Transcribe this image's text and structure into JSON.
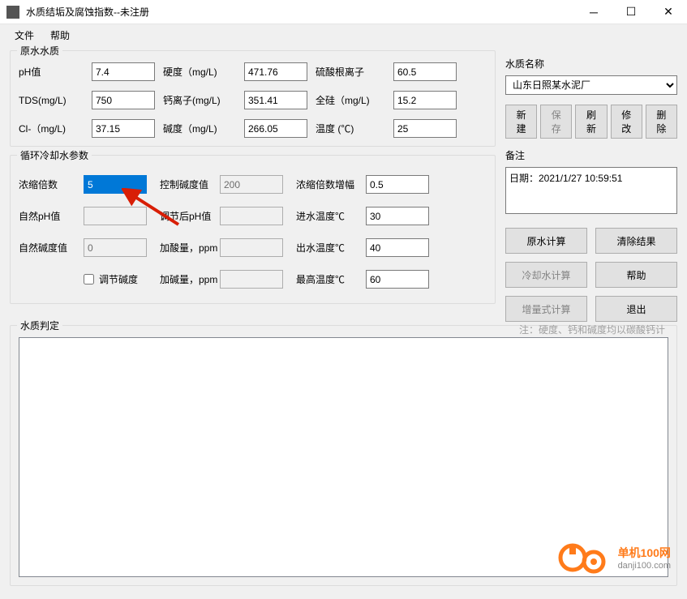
{
  "window": {
    "title": "水质结垢及腐蚀指数--未注册"
  },
  "menu": {
    "file": "文件",
    "help": "帮助"
  },
  "rawWater": {
    "title": "原水水质",
    "ph_label": "pH值",
    "ph": "7.4",
    "hardness_label": "硬度（mg/L)",
    "hardness": "471.76",
    "sulfate_label": "硫酸根离子",
    "sulfate": "60.5",
    "tds_label": "TDS(mg/L)",
    "tds": "750",
    "calcium_label": "钙离子(mg/L)",
    "calcium": "351.41",
    "silica_label": "全硅（mg/L)",
    "silica": "15.2",
    "cl_label": "Cl-（mg/L)",
    "cl": "37.15",
    "alkalinity_label": "碱度（mg/L)",
    "alkalinity": "266.05",
    "temp_label": "温度 (℃)",
    "temp": "25"
  },
  "cooling": {
    "title": "循环冷却水参数",
    "conc_label": "浓缩倍数",
    "conc": "5",
    "ctrlalk_label": "控制碱度值",
    "ctrlalk": "200",
    "concinc_label": "浓缩倍数增幅",
    "concinc": "0.5",
    "natph_label": "自然pH值",
    "natph": "",
    "adjph_label": "调节后pH值",
    "adjph": "",
    "intemp_label": "进水温度℃",
    "intemp": "30",
    "natalk_label": "自然碱度值",
    "natalk": "0",
    "acid_label": "加酸量，ppm",
    "acid": "",
    "outtemp_label": "出水温度℃",
    "outtemp": "40",
    "adjalk_label": "调节碱度",
    "base_label": "加碱量，ppm",
    "base": "",
    "maxtemp_label": "最高温度℃",
    "maxtemp": "60"
  },
  "right": {
    "name_label": "水质名称",
    "name_value": "山东日照某水泥厂",
    "new": "新建",
    "save": "保存",
    "refresh": "刷新",
    "modify": "修改",
    "delete": "删除",
    "remark_label": "备注",
    "remark": "日期：2021/1/27 10:59:51",
    "calc_raw": "原水计算",
    "clear": "清除结果",
    "calc_cool": "冷却水计算",
    "help": "帮助",
    "calc_inc": "增量式计算",
    "exit": "退出"
  },
  "judge": {
    "title": "水质判定",
    "note": "注：硬度、钙和碱度均以碳酸钙计"
  },
  "watermark": {
    "brand": "单机100网",
    "url": "danji100.com"
  }
}
